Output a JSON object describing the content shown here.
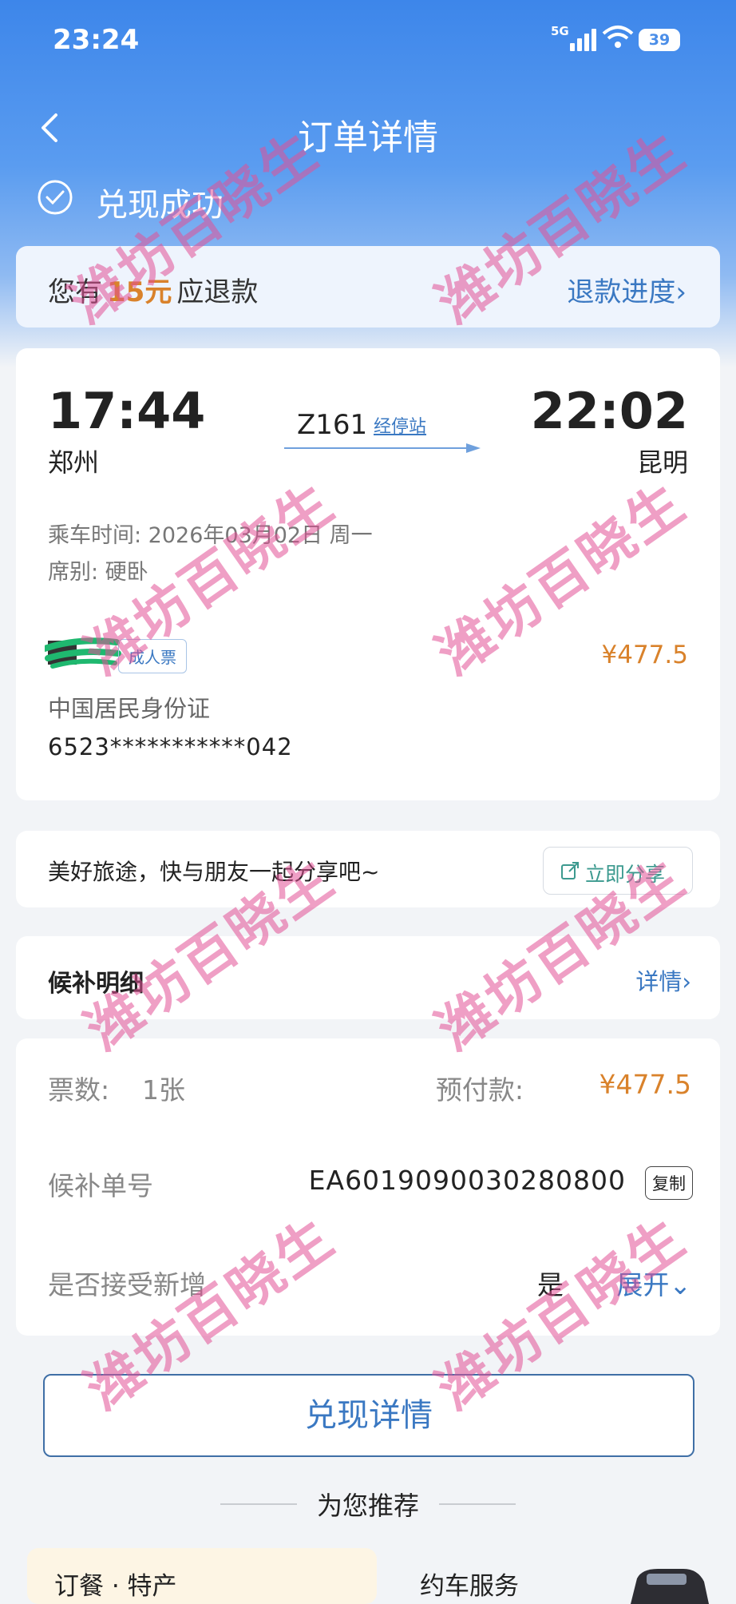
{
  "status_bar": {
    "time": "23:24",
    "network": "5G",
    "battery": "39"
  },
  "nav": {
    "title": "订单详情"
  },
  "status_row": {
    "label": "兑现成功"
  },
  "refund": {
    "prefix": "您有",
    "amount": "15元",
    "suffix": "应退款",
    "progress_link": "退款进度›"
  },
  "ticket": {
    "depart_time": "17:44",
    "depart_station": "郑州",
    "arrive_time": "22:02",
    "arrive_station": "昆明",
    "train_no": "Z161",
    "stops_link": "经停站",
    "ride_date": "乘车时间: 2026年03月02日 周一",
    "seat_class": "席别: 硬卧",
    "ticket_type": "成人票",
    "price": "¥477.5",
    "id_type": "中国居民身份证",
    "id_number": "6523***********042"
  },
  "share": {
    "text": "美好旅途，快与朋友一起分享吧~",
    "button": "立即分享"
  },
  "waitlist": {
    "title": "候补明细",
    "detail_link": "详情›"
  },
  "details": {
    "ticket_count_label": "票数:",
    "ticket_count": "1张",
    "prepay_label": "预付款:",
    "prepay_value": "¥477.5",
    "order_label": "候补单号",
    "order_no": "EA6019090030280800",
    "copy_button": "复制",
    "accept_label": "是否接受新增",
    "accept_value": "是",
    "expand_link": "展开⌄"
  },
  "cash_button": "兑现详情",
  "recommend": {
    "title": "为您推荐"
  },
  "tiles": [
    {
      "label": "订餐 · 特产"
    },
    {
      "label": "约车服务"
    }
  ],
  "watermark": "潍坊百晓生",
  "colors": {
    "accent_blue": "#3a78c2",
    "price_orange": "#d9822b",
    "header_blue": "#3d86ea"
  }
}
